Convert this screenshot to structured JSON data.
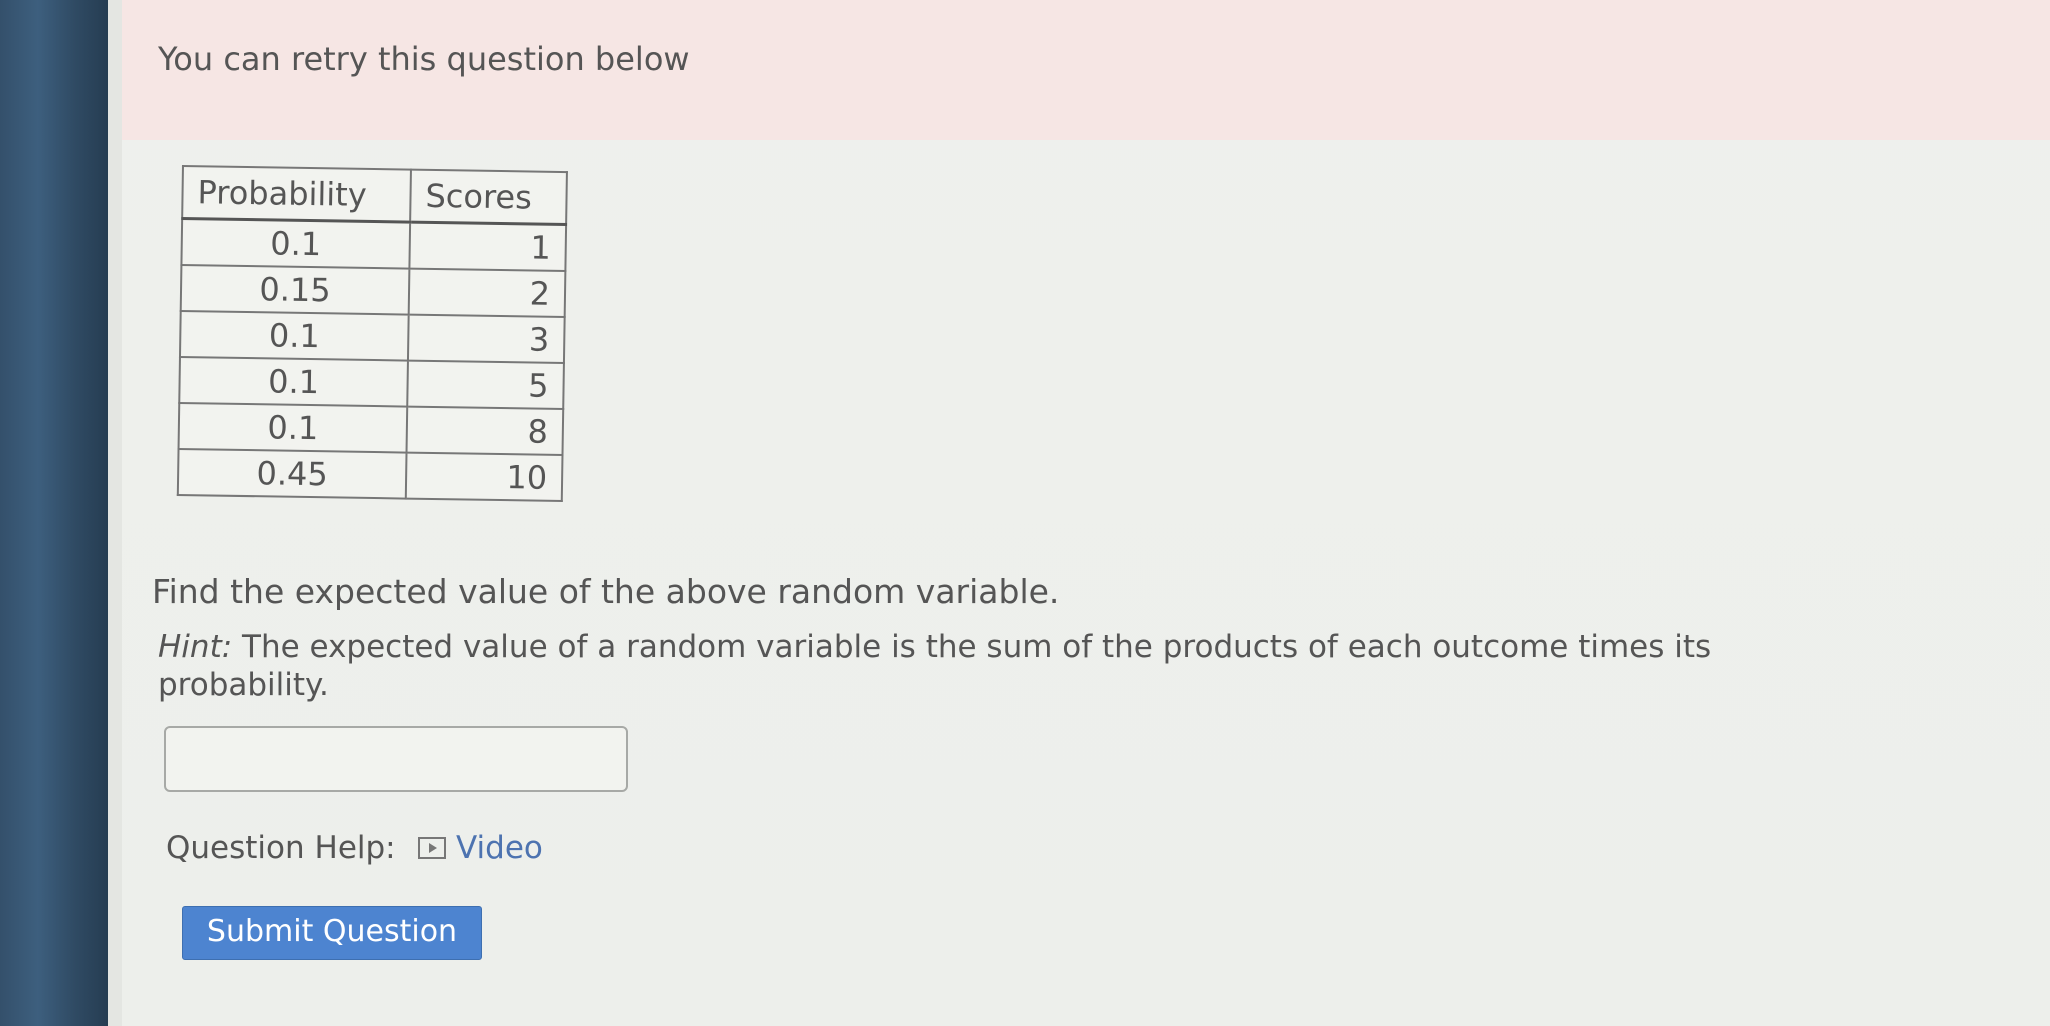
{
  "banner": {
    "retry_text": "You can retry this question below"
  },
  "table": {
    "headers": [
      "Probability",
      "Scores"
    ],
    "rows": [
      {
        "probability": "0.1",
        "score": "1"
      },
      {
        "probability": "0.15",
        "score": "2"
      },
      {
        "probability": "0.1",
        "score": "3"
      },
      {
        "probability": "0.1",
        "score": "5"
      },
      {
        "probability": "0.1",
        "score": "8"
      },
      {
        "probability": "0.45",
        "score": "10"
      }
    ]
  },
  "question": {
    "prompt": "Find the expected value of the above random variable.",
    "hint_label": "Hint:",
    "hint_text": " The expected value of a random variable is the sum of the products of each outcome times its probability."
  },
  "answer": {
    "value": "",
    "placeholder": ""
  },
  "help": {
    "label": "Question Help:",
    "video_label": "Video",
    "video_icon": "video-play-icon"
  },
  "actions": {
    "submit_label": "Submit Question",
    "submit_color": "#4d84d0"
  },
  "colors": {
    "banner_bg": "#f6e6e4",
    "link": "#4d73b0",
    "bezel": "#34506b"
  }
}
